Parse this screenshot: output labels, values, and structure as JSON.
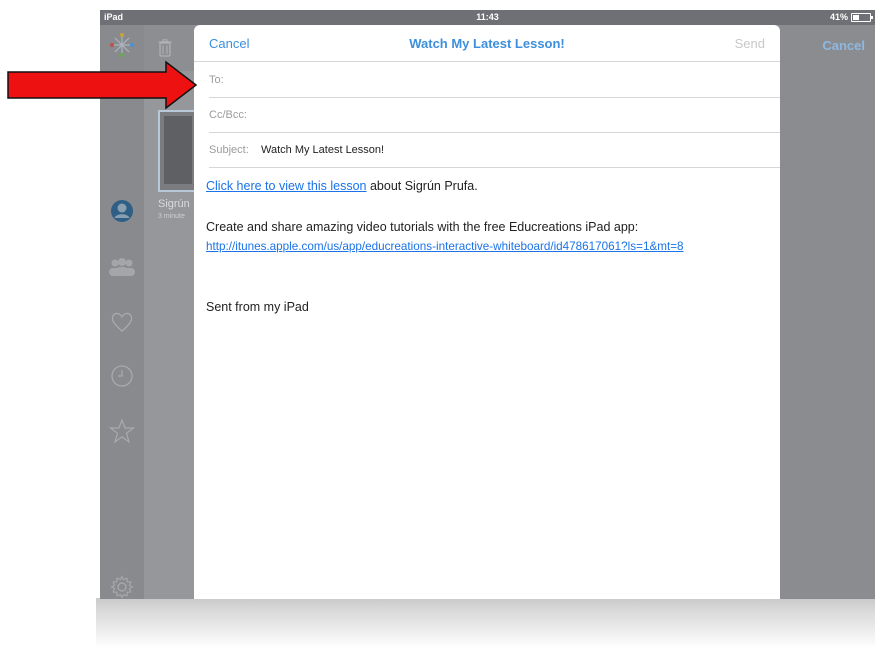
{
  "status": {
    "carrier": "iPad",
    "time": "11:43",
    "battery": "41%"
  },
  "background_app": {
    "item_title": "Sigrún",
    "item_subtitle": "3 minute",
    "cancel_label": "Cancel",
    "sidebar_icons": [
      "app-logo-icon",
      "trash-icon",
      "profile-icon",
      "group-icon",
      "heart-icon",
      "clock-icon",
      "star-icon",
      "settings-gear-icon"
    ]
  },
  "compose": {
    "cancel_label": "Cancel",
    "title": "Watch My Latest Lesson!",
    "send_label": "Send",
    "to_label": "To:",
    "cc_label": "Cc/Bcc:",
    "subject_label": "Subject:",
    "subject_value": "Watch My Latest Lesson!",
    "body": {
      "link_text": "Click here to view this lesson",
      "link_suffix": " about Sigrún Prufa.",
      "promo_text": "Create and share amazing video tutorials with the free Educreations iPad app:",
      "promo_url": "http://itunes.apple.com/us/app/educreations-interactive-whiteboard/id478617061?ls=1&mt=8",
      "signature": "Sent from my iPad"
    }
  },
  "annotation": {
    "arrow_color": "#ee1111"
  }
}
